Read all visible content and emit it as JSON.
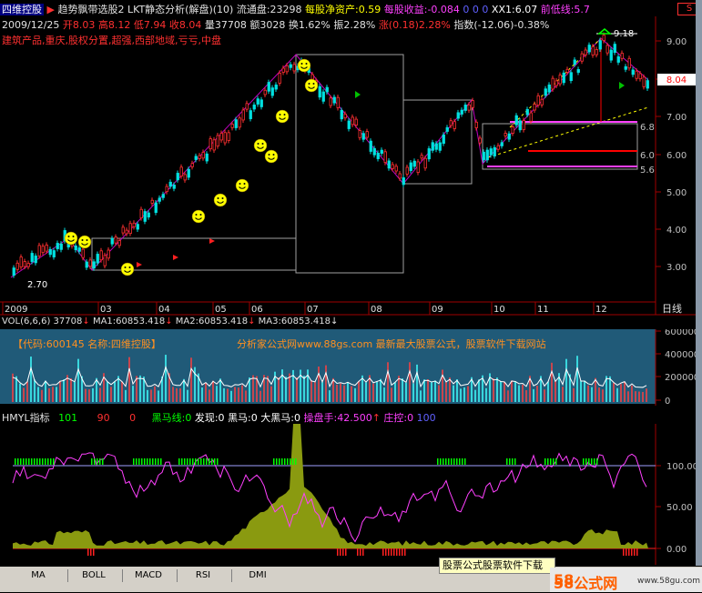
{
  "header": {
    "stock_name": "四维控股",
    "indicator_name": "趋势飘带选股2",
    "indicator_params": "LKT静态分析(解盘)(10)",
    "float_label": "流通盘:23298",
    "nav_label": "每股净资产:0.59",
    "eps_label": "每股收益:-0.084",
    "zeros": "0  0  0",
    "xx1_label": "XX1:6.07",
    "prev_low_label": "前低线:5.7",
    "close_box_label": "S"
  },
  "quote_line": {
    "date": "2009/12/25",
    "open": "开8.03",
    "high": "高8.12",
    "low": "低7.94",
    "close": "收8.04",
    "volume": "量37708",
    "amount": "额3028",
    "turnover": "换1.62%",
    "amplitude": "振2.28%",
    "change": "涨(0.18)2.28%",
    "index": "指数(-12.06)-0.38%"
  },
  "concept_line": "建筑产品,重庆,股权分置,超强,西部地域,亏亏,中盘",
  "price_chart": {
    "y_ticks": [
      "9.00",
      "8.00",
      "7.00",
      "6.00",
      "5.00",
      "4.00",
      "3.00"
    ],
    "current_price": "8.04",
    "annotations": {
      "top_right": "9.18",
      "low_left": "2.70",
      "level_1": "6.8",
      "level_2": "6.0",
      "level_3": "5.6"
    },
    "month_labels": [
      "2009",
      "03",
      "04",
      "05",
      "06",
      "07",
      "08",
      "09",
      "10",
      "11",
      "12"
    ],
    "period_label": "日线"
  },
  "volume_chart": {
    "title": "VOL(6,6,6)",
    "value": "37708",
    "ma1": "MA1:60853.418",
    "ma2": "MA2:60853.418",
    "ma3": "MA3:60853.418",
    "code_text": "【代码:600145 名称:四维控股】",
    "promo_text": "分析家公式网www.88gs.com 最新最大股票公式，股票软件下载网站",
    "y_ticks": [
      "600000",
      "400000",
      "200000",
      "0"
    ]
  },
  "indicator_chart": {
    "title": "HMYL指标",
    "v1": "101",
    "v2": "90",
    "v3": "0",
    "black_horse_line": "黑马线:0",
    "discover": "发现:0",
    "black_horse": "黑马:0",
    "big_black_horse": "大黑马:0",
    "trader": "操盘手:42.500",
    "pressure": "庄控:0",
    "v4": "100",
    "y_ticks": [
      "100.00",
      "50.00",
      "0.00"
    ]
  },
  "tabs": [
    "MA",
    "BOLL",
    "MACD",
    "RSI",
    "DMI"
  ],
  "ad_text": "股票公式股票软件下载",
  "watermark": "58公式网",
  "watermark_url": "www.58gu.com"
}
